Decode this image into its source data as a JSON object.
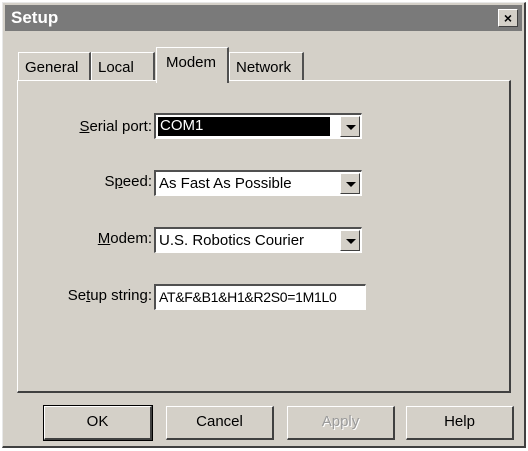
{
  "window": {
    "title": "Setup",
    "close_label": "×"
  },
  "tabs": [
    {
      "label": "General",
      "active": false
    },
    {
      "label": "Local",
      "active": false
    },
    {
      "label": "Modem",
      "active": true
    },
    {
      "label": "Network",
      "active": false
    }
  ],
  "form": {
    "serial_port": {
      "label_pre": "",
      "label_u": "S",
      "label_post": "erial port:",
      "value": "COM1"
    },
    "speed": {
      "label_pre": "S",
      "label_u": "p",
      "label_post": "eed:",
      "value": "As Fast As Possible"
    },
    "modem": {
      "label_pre": "",
      "label_u": "M",
      "label_post": "odem:",
      "value": "U.S. Robotics Courier"
    },
    "setup_string": {
      "label_pre": "Se",
      "label_u": "t",
      "label_post": "up string:",
      "value": "AT&F&B1&H1&R2S0=1M1L0"
    }
  },
  "buttons": {
    "ok": "OK",
    "cancel": "Cancel",
    "apply": "Apply",
    "help": "Help"
  }
}
